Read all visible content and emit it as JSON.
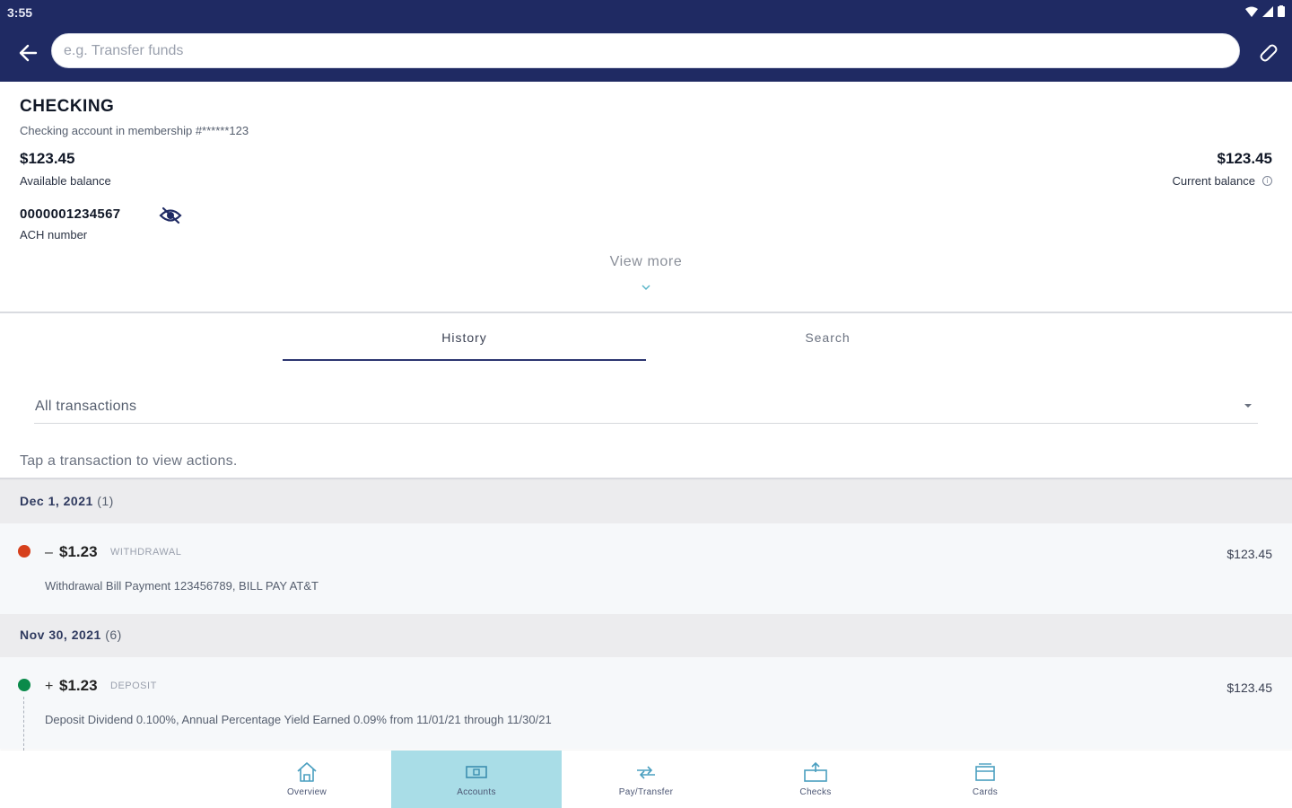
{
  "status_bar": {
    "time": "3:55"
  },
  "header": {
    "search_placeholder": "e.g. Transfer funds"
  },
  "account": {
    "name": "CHECKING",
    "description": "Checking account in membership #******123",
    "available_balance": "$123.45",
    "available_label": "Available balance",
    "current_balance": "$123.45",
    "current_label": "Current balance",
    "info_glyph": "i",
    "ach_number": "0000001234567",
    "ach_label": "ACH number",
    "view_more": "View more"
  },
  "tabs": [
    {
      "label": "History",
      "active": true
    },
    {
      "label": "Search",
      "active": false
    }
  ],
  "filter": {
    "selected": "All transactions"
  },
  "hint": "Tap a transaction to view actions.",
  "groups": [
    {
      "date": "Dec 1, 2021",
      "count": "(1)",
      "transactions": [
        {
          "sign": "–",
          "amount": "$1.23",
          "type": "WITHDRAWAL",
          "balance": "$123.45",
          "description": "Withdrawal Bill Payment 123456789, BILL PAY AT&T",
          "dot_color": "#d6401c"
        }
      ]
    },
    {
      "date": "Nov 30, 2021",
      "count": "(6)",
      "transactions": [
        {
          "sign": "+",
          "amount": "$1.23",
          "type": "DEPOSIT",
          "balance": "$123.45",
          "description": "Deposit Dividend 0.100%, Annual Percentage Yield Earned 0.09% from 11/01/21 through 11/30/21",
          "dot_color": "#0a8a4a"
        }
      ]
    }
  ],
  "bottom_nav": [
    {
      "label": "Overview",
      "icon": "home-icon",
      "active": false
    },
    {
      "label": "Accounts",
      "icon": "accounts-icon",
      "active": true
    },
    {
      "label": "Pay/Transfer",
      "icon": "transfer-icon",
      "active": false
    },
    {
      "label": "Checks",
      "icon": "check-deposit-icon",
      "active": false
    },
    {
      "label": "Cards",
      "icon": "cards-icon",
      "active": false
    }
  ],
  "colors": {
    "header_bg": "#1f2a63",
    "accent": "#2c3670",
    "nav_active_bg": "#a9dde7",
    "withdrawal_dot": "#d6401c",
    "deposit_dot": "#0a8a4a"
  }
}
